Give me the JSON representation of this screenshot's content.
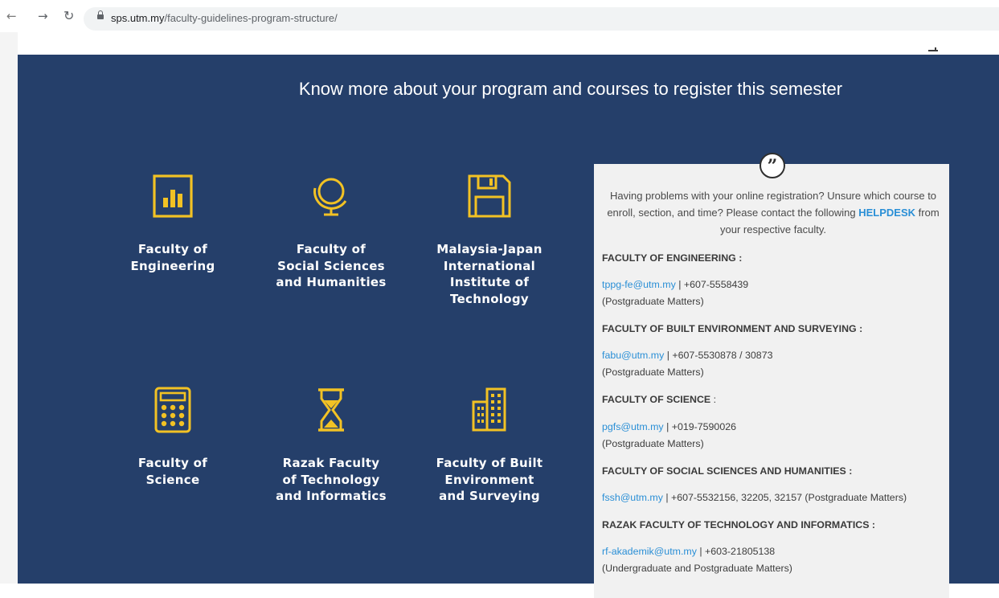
{
  "browser": {
    "back_icon": "arrow-left-icon",
    "forward_icon": "arrow-right-icon",
    "reload_icon": "reload-icon",
    "url_host": "sps.utm.my",
    "url_path": "/faculty-guidelines-program-structure/"
  },
  "colors": {
    "section_bg": "#253f6a",
    "icon_yellow": "#f2c224",
    "panel_bg": "#f1f1f1",
    "link_blue": "#2a8fd6"
  },
  "section": {
    "headline": "Know more about your program and courses to register this semester"
  },
  "faculties": [
    {
      "icon": "bar-chart-icon",
      "name": "Faculty of Engineering"
    },
    {
      "icon": "globe-icon",
      "name": "Faculty of Social Sciences and Humanities"
    },
    {
      "icon": "floppy-disk-icon",
      "name": "Malaysia-Japan International Institute of Technology"
    },
    {
      "icon": "calculator-icon",
      "name": "Faculty of Science"
    },
    {
      "icon": "hourglass-icon",
      "name": "Razak Faculty of Technology and Informatics"
    },
    {
      "icon": "buildings-icon",
      "name": "Faculty of Built Environment and Surveying"
    }
  ],
  "helpdesk": {
    "quote_icon": "quote-icon",
    "intro_before": "Having problems with your online registration? Unsure which course to enroll, section, and time? Please contact the following ",
    "intro_link": "HELPDESK",
    "intro_after": " from your respective faculty.",
    "contacts": [
      {
        "heading": "FACULTY OF ENGINEERING :",
        "email": "tppg-fe@utm.my",
        "phone": " | +607-5558439",
        "note": "(Postgraduate Matters)"
      },
      {
        "heading": "FACULTY OF BUILT ENVIRONMENT AND SURVEYING :",
        "email": "fabu@utm.my",
        "phone": " | +607-5530878 / 30873",
        "note": "(Postgraduate Matters)"
      },
      {
        "heading": "FACULTY OF SCIENCE",
        "heading_suffix": " :",
        "email": "pgfs@utm.my",
        "phone": " | +019-7590026",
        "note": "(Postgraduate Matters)"
      },
      {
        "heading": "FACULTY OF SOCIAL SCIENCES AND HUMANITIES :",
        "email": "fssh@utm.my",
        "phone": " | +607-5532156, 32205, 32157 (Postgraduate Matters)",
        "note": ""
      },
      {
        "heading": "RAZAK FACULTY OF TECHNOLOGY AND INFORMATICS :",
        "email": "rf-akademik@utm.my",
        "phone": " | +603-21805138",
        "note": "(Undergraduate and Postgraduate Matters)"
      }
    ]
  }
}
